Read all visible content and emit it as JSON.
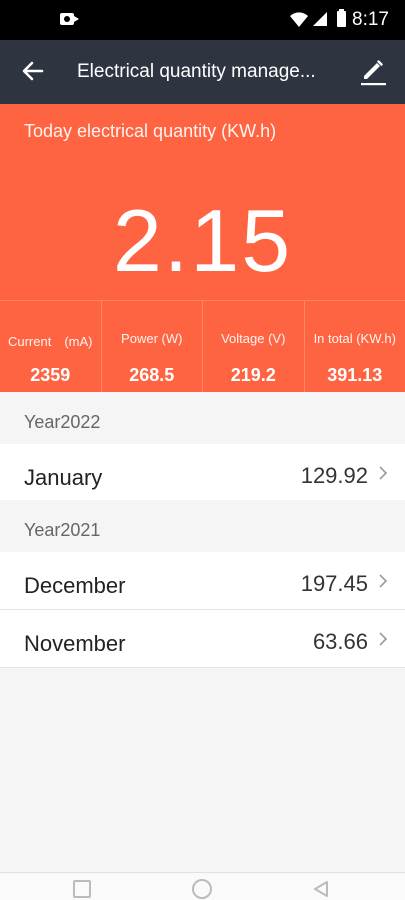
{
  "status_bar": {
    "time": "8:17",
    "icons": [
      "video-camera-icon",
      "wifi-icon",
      "cell-signal-icon",
      "battery-icon"
    ]
  },
  "app_bar": {
    "title": "Electrical quantity manage...",
    "back_icon": "arrow-left-icon",
    "edit_icon": "pencil-icon"
  },
  "today": {
    "label": "Today electrical quantity (KW.h)",
    "value": "2.15"
  },
  "stats": [
    {
      "label": "Current　(mA)",
      "value": "2359"
    },
    {
      "label": "Power (W)",
      "value": "268.5"
    },
    {
      "label": "Voltage (V)",
      "value": "219.2"
    },
    {
      "label": "In total (KW.h)",
      "value": "391.13"
    }
  ],
  "years": [
    {
      "label": "Year2022",
      "months": [
        {
          "name": "January",
          "value": "129.92"
        }
      ]
    },
    {
      "label": "Year2021",
      "months": [
        {
          "name": "December",
          "value": "197.45"
        },
        {
          "name": "November",
          "value": "63.66"
        }
      ]
    }
  ],
  "colors": {
    "accent": "#ff6442",
    "app_bar": "#2e3440",
    "background": "#f5f5f5"
  },
  "nav_bar": {
    "icons": [
      "recents-square-icon",
      "home-circle-icon",
      "back-triangle-icon"
    ]
  }
}
